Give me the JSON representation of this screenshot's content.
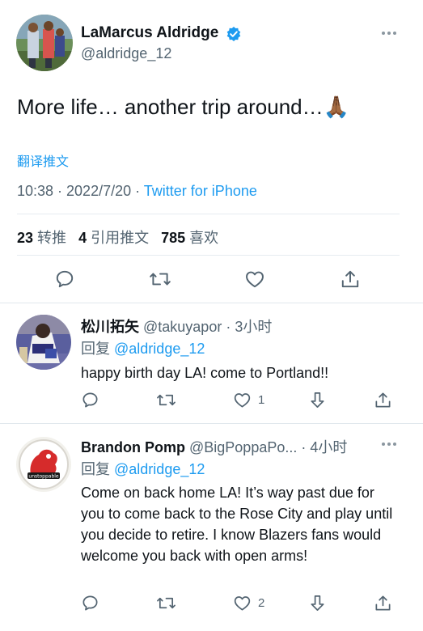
{
  "tweet": {
    "author_name": "LaMarcus Aldridge",
    "author_handle": "@aldridge_12",
    "text": "More life… another trip around…🙏🏾",
    "translate_label": "翻译推文",
    "time": "10:38 · 2022/7/20 · ",
    "source": "Twitter for iPhone",
    "stats": {
      "retweets_count": "23",
      "retweets_label": "转推",
      "quotes_count": "4",
      "quotes_label": "引用推文",
      "likes_count": "785",
      "likes_label": "喜欢"
    }
  },
  "replies": [
    {
      "name": "松川拓矢",
      "rest": " @takuyapor · 3小时",
      "reply_label": "回复 ",
      "mention": "@aldridge_12",
      "text": "happy birth day LA! come to Portland!!",
      "like_count": "1"
    },
    {
      "name": "Brandon Pomp",
      "rest": " @BigPoppaPo... · 4小时",
      "reply_label": "回复 ",
      "mention": "@aldridge_12",
      "text": "Come on back home LA! It’s way past due for you to come back to the Rose City and play until you decide to retire. I know Blazers fans would welcome you back with open arms!",
      "like_count": "2"
    }
  ],
  "colors": {
    "accent": "#1d9bf0",
    "secondary_text": "#536471",
    "icon": "#536471"
  },
  "icons": [
    "reply-icon",
    "retweet-icon",
    "like-icon",
    "dislike-icon",
    "share-icon",
    "verified-icon",
    "more-icon"
  ]
}
